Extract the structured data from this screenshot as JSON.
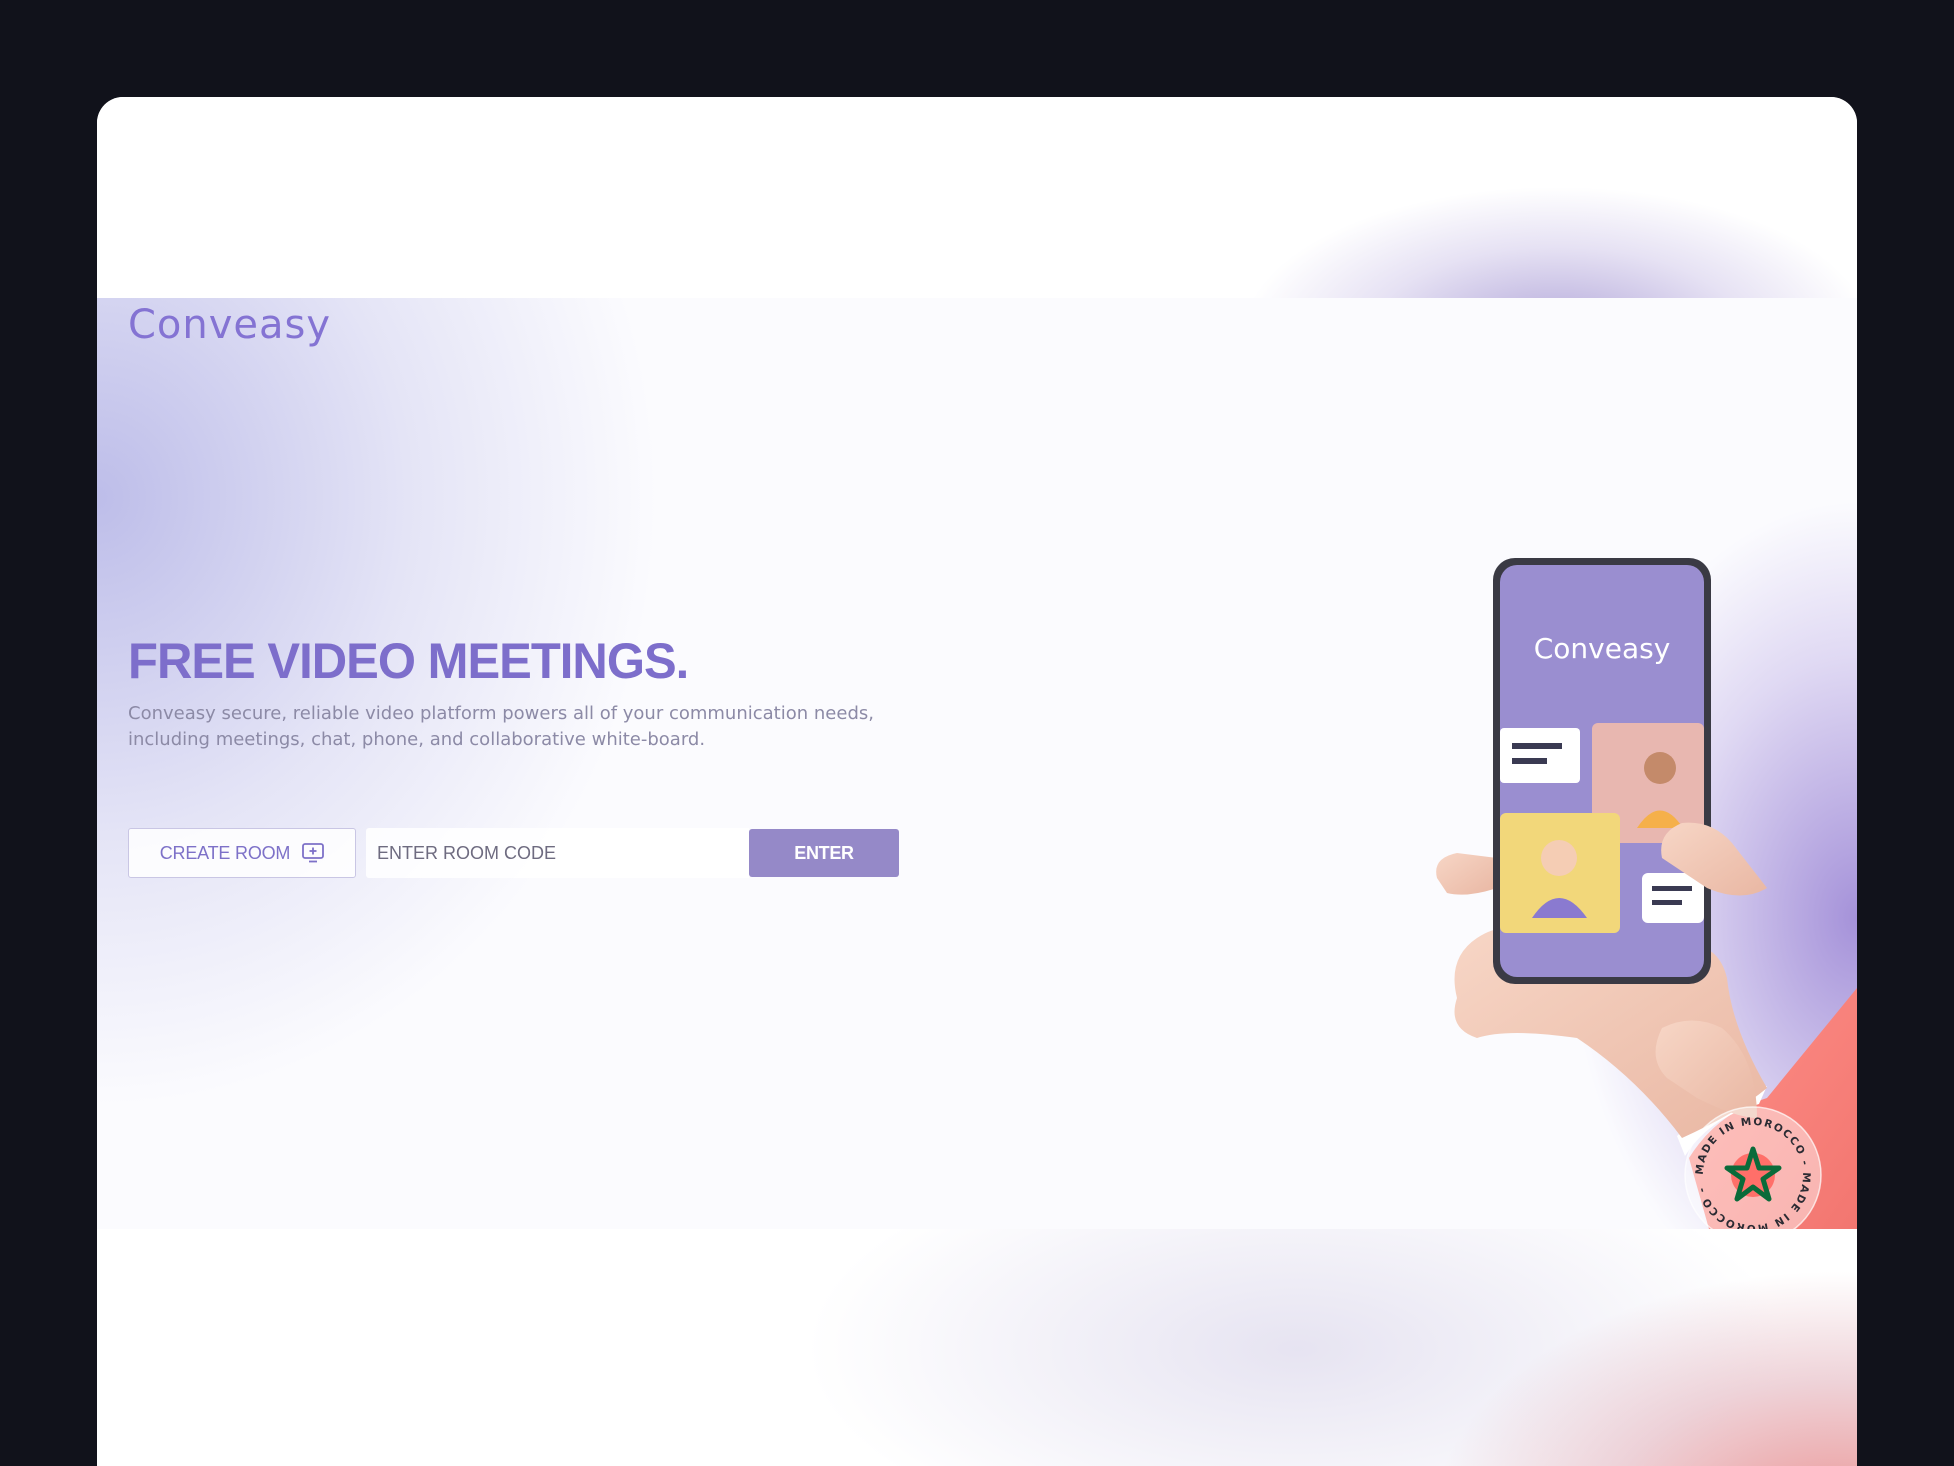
{
  "brand": {
    "logo": "Conveasy",
    "accent": "#8473d3",
    "primary_button_color": "#9589c8",
    "background": "#11121b"
  },
  "hero": {
    "headline": "FREE VIDEO MEETINGS.",
    "description_lines": [
      "Conveasy secure, reliable video platform powers all of your communication needs,",
      "including meetings, chat, phone, and collaborative white-board."
    ]
  },
  "actions": {
    "create_room_label": "CREATE ROOM",
    "create_room_icon": "add-screen-icon",
    "room_code_placeholder": "ENTER ROOM CODE",
    "room_code_value": "",
    "enter_label": "ENTER"
  },
  "illustration": {
    "phone_app_title": "Conveasy",
    "description": "hand-holding-phone"
  },
  "badge": {
    "text": "MADE IN MOROCCO - MADE IN MOROCCO - ",
    "icon": "moroccan-star-icon"
  }
}
